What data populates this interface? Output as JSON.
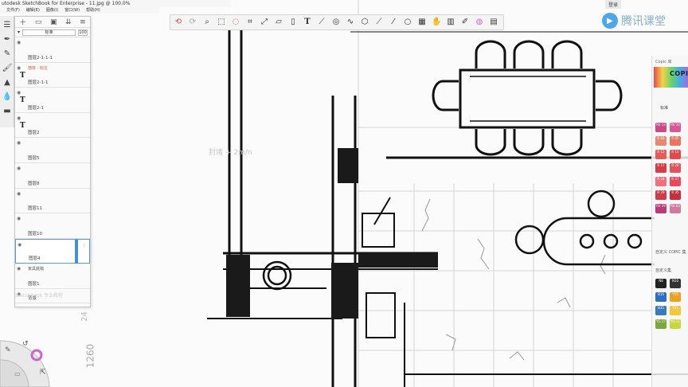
{
  "window": {
    "title": "Autodesk SketchBook for Enterprise - 11.jpg @ 100.0%",
    "title_visible": "utodesk SketchBook for Enterprise - 11.jpg @ 100.0%"
  },
  "menu": [
    "文件(F)",
    "编辑(E)",
    "图像(I)",
    "窗口(W)",
    "帮助(H)"
  ],
  "account": {
    "signin_label": "登录"
  },
  "logo": {
    "text": "腾讯课堂"
  },
  "layer_panel": {
    "blend_mode": "标准",
    "opacity": "100",
    "layers": [
      {
        "name": "图层2-1-1-1",
        "type": "image",
        "selected": false
      },
      {
        "name": "图层2-1-1",
        "type": "text",
        "red_label": "墙体 · 标注",
        "selected": false
      },
      {
        "name": "图层2-1",
        "type": "text",
        "selected": false
      },
      {
        "name": "图层2",
        "type": "text",
        "selected": false
      },
      {
        "name": "图层5",
        "type": "image",
        "selected": false
      },
      {
        "name": "图层8",
        "type": "image",
        "selected": false
      },
      {
        "name": "图层11",
        "type": "image",
        "selected": false
      },
      {
        "name": "图层10",
        "type": "image",
        "selected": false
      },
      {
        "name": "图层4",
        "type": "image",
        "selected": true
      },
      {
        "name": "图层1",
        "type": "image",
        "extra": "家具底稿",
        "selected": false
      },
      {
        "name": "背景",
        "type": "background",
        "selected": false
      }
    ]
  },
  "canvas": {
    "watermark": "封堵 + 2m/n",
    "bottom_watermark": "SketchBook 专业教程",
    "ruler_label": "1260",
    "ruler_label2": "24"
  },
  "copic": {
    "library_label": "Copic 库",
    "brand": "COPIC",
    "tab_label": "标准",
    "custom_set_label": "自定义 COPIC 集",
    "set_name": "自定义集",
    "swatches": [
      "RV 13",
      "RV 10",
      "R 02",
      "R 05",
      "R 11",
      "R 14",
      "R 17",
      "R 20",
      "R 24",
      "R 27",
      "R 29",
      "R 35",
      "RV 29",
      "RV 63"
    ],
    "bottom_swatches": [
      "N8",
      "N10",
      "B16",
      "Y15",
      "B35",
      "Y21",
      "YG 17",
      "YG 21"
    ]
  },
  "colors": {
    "accent_blue": "#4a8fd6",
    "copic_red": "#e0545a",
    "copic_pink": "#f29aa6",
    "ink": "#111111"
  }
}
